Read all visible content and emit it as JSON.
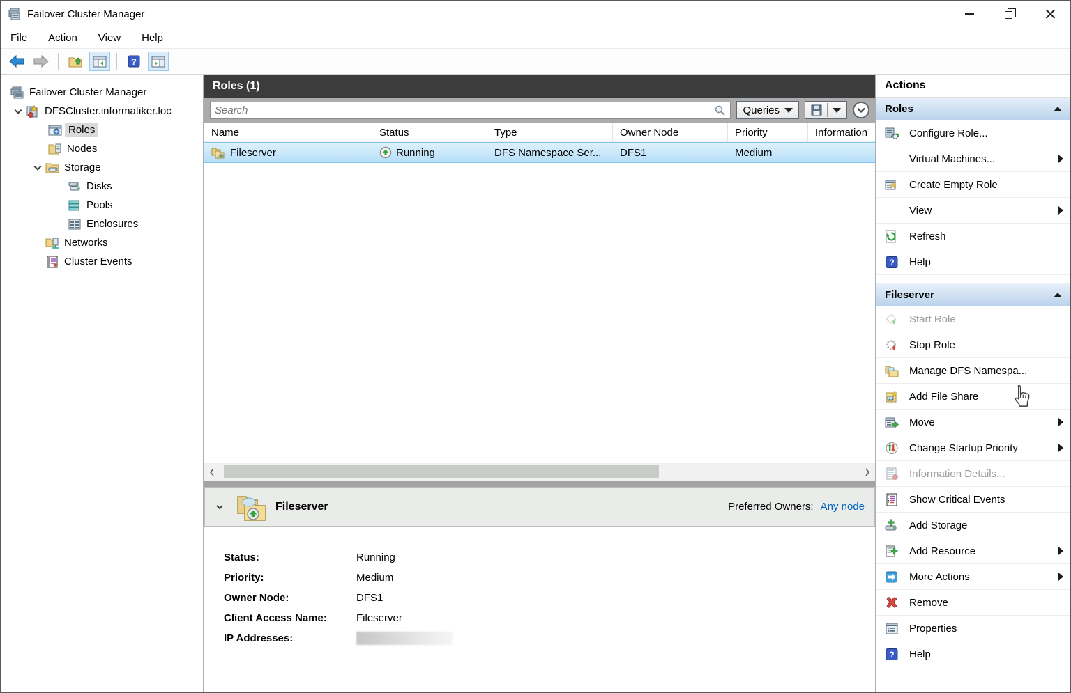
{
  "window": {
    "title": "Failover Cluster Manager"
  },
  "menu": {
    "file": "File",
    "action": "Action",
    "view": "View",
    "help": "Help"
  },
  "tree": {
    "root": "Failover Cluster Manager",
    "cluster": "DFSCluster.informatiker.loc",
    "roles": "Roles",
    "nodes": "Nodes",
    "storage": "Storage",
    "disks": "Disks",
    "pools": "Pools",
    "enclosures": "Enclosures",
    "networks": "Networks",
    "cluster_events": "Cluster Events"
  },
  "main": {
    "header": "Roles (1)",
    "search_placeholder": "Search",
    "queries_label": "Queries",
    "columns": {
      "name": "Name",
      "status": "Status",
      "type": "Type",
      "owner_node": "Owner Node",
      "priority": "Priority",
      "information": "Information"
    },
    "row": {
      "name": "Fileserver",
      "status": "Running",
      "type": "DFS Namespace Ser...",
      "owner_node": "DFS1",
      "priority": "Medium"
    }
  },
  "detail": {
    "title": "Fileserver",
    "preferred_owners_label": "Preferred Owners:",
    "preferred_owners_value": "Any node",
    "fields": [
      {
        "label": "Status:",
        "value": "Running"
      },
      {
        "label": "Priority:",
        "value": "Medium"
      },
      {
        "label": "Owner Node:",
        "value": "DFS1"
      },
      {
        "label": "Client Access Name:",
        "value": "Fileserver"
      },
      {
        "label": "IP Addresses:",
        "value": ""
      }
    ]
  },
  "actions": {
    "title": "Actions",
    "roles_section": {
      "title": "Roles",
      "items": [
        {
          "label": "Configure Role..."
        },
        {
          "label": "Virtual Machines...",
          "submenu": true
        },
        {
          "label": "Create Empty Role"
        },
        {
          "label": "View",
          "submenu": true
        },
        {
          "label": "Refresh"
        },
        {
          "label": "Help"
        }
      ]
    },
    "fileserver_section": {
      "title": "Fileserver",
      "items": [
        {
          "label": "Start Role",
          "disabled": true
        },
        {
          "label": "Stop Role"
        },
        {
          "label": "Manage DFS Namespa..."
        },
        {
          "label": "Add File Share"
        },
        {
          "label": "Move",
          "submenu": true
        },
        {
          "label": "Change Startup Priority",
          "submenu": true
        },
        {
          "label": "Information Details...",
          "disabled": true
        },
        {
          "label": "Show Critical Events"
        },
        {
          "label": "Add Storage"
        },
        {
          "label": "Add Resource",
          "submenu": true
        },
        {
          "label": "More Actions",
          "submenu": true
        },
        {
          "label": "Remove"
        },
        {
          "label": "Properties"
        },
        {
          "label": "Help"
        }
      ]
    }
  }
}
